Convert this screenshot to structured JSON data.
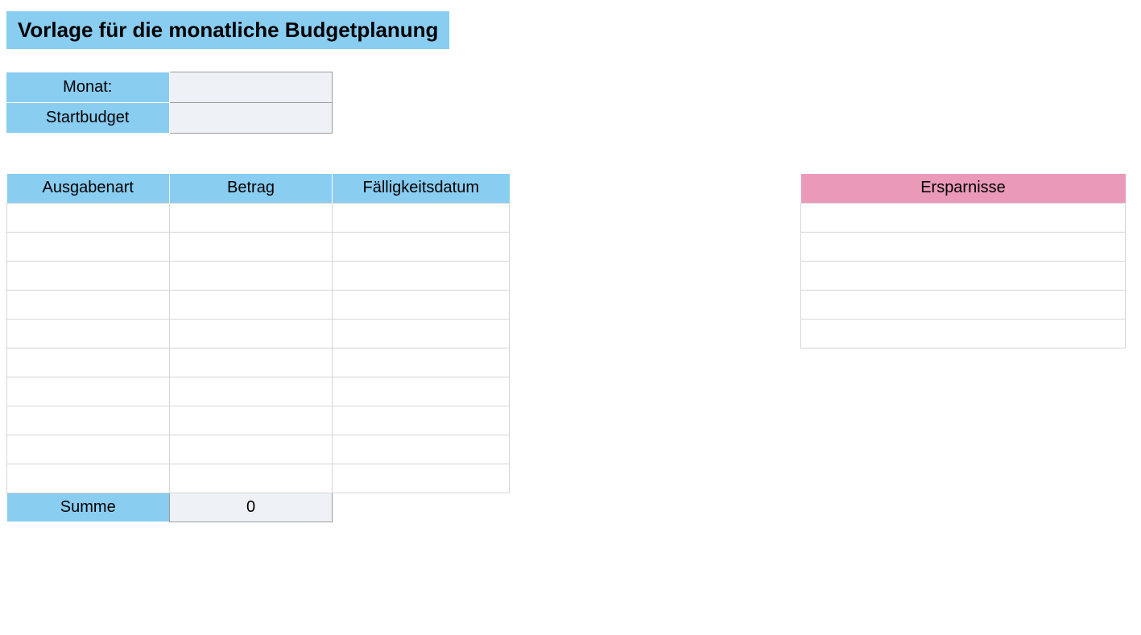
{
  "title": "Vorlage für die monatliche Budgetplanung",
  "top": {
    "month_label": "Monat:",
    "month_value": "",
    "startbudget_label": "Startbudget",
    "startbudget_value": ""
  },
  "expenses": {
    "headers": {
      "type": "Ausgabenart",
      "amount": "Betrag",
      "due": "Fälligkeitsdatum"
    },
    "rows": [
      {
        "type": "",
        "amount": "",
        "due": ""
      },
      {
        "type": "",
        "amount": "",
        "due": ""
      },
      {
        "type": "",
        "amount": "",
        "due": ""
      },
      {
        "type": "",
        "amount": "",
        "due": ""
      },
      {
        "type": "",
        "amount": "",
        "due": ""
      },
      {
        "type": "",
        "amount": "",
        "due": ""
      },
      {
        "type": "",
        "amount": "",
        "due": ""
      },
      {
        "type": "",
        "amount": "",
        "due": ""
      },
      {
        "type": "",
        "amount": "",
        "due": ""
      },
      {
        "type": "",
        "amount": "",
        "due": ""
      }
    ],
    "sum_label": "Summe",
    "sum_value": "0"
  },
  "savings": {
    "header": "Ersparnisse",
    "rows": [
      "",
      "",
      "",
      "",
      ""
    ]
  }
}
